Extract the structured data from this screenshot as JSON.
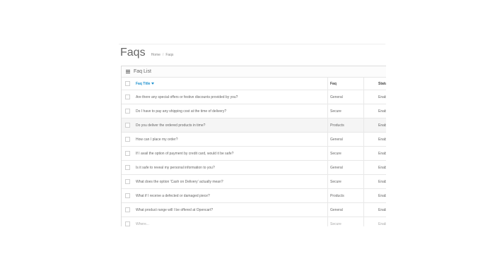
{
  "header": {
    "title": "Faqs",
    "breadcrumb": [
      "Home",
      "Faqs"
    ]
  },
  "panel": {
    "title": "Faq List"
  },
  "table": {
    "columns": {
      "title": "Faq Title",
      "faq": "Faq",
      "status": "Status"
    },
    "rows": [
      {
        "title": "Are there any special offers or festive discounts provided by you?",
        "faq": "General",
        "status": "Enable"
      },
      {
        "title": "Do I have to pay any shipping cost at the time of delivery?",
        "faq": "Secure",
        "status": "Enable"
      },
      {
        "title": "Do you deliver the ordered products in time?",
        "faq": "Products",
        "status": "Enable"
      },
      {
        "title": "How can I place my order?",
        "faq": "General",
        "status": "Enable"
      },
      {
        "title": "If I avail the option of payment by credit card, would it be safe?",
        "faq": "Secure",
        "status": "Enable"
      },
      {
        "title": "Is it safe to reveal my personal information to you?",
        "faq": "General",
        "status": "Enable"
      },
      {
        "title": "What does the option 'Cash on Delivery' actually mean?",
        "faq": "Secure",
        "status": "Enable"
      },
      {
        "title": "What if I receive a defected or damaged piece?",
        "faq": "Products",
        "status": "Enable"
      },
      {
        "title": "What product range will I be offered at Opencart?",
        "faq": "General",
        "status": "Enable"
      },
      {
        "title": "Where...",
        "faq": "Secure",
        "status": "Enable"
      }
    ]
  },
  "colors": {
    "accent": "#1e91cf",
    "border": "#dddddd",
    "highlight": "#f5f5f5"
  },
  "icons": {
    "panel": "list-icon",
    "sort": "caret-down-icon"
  }
}
